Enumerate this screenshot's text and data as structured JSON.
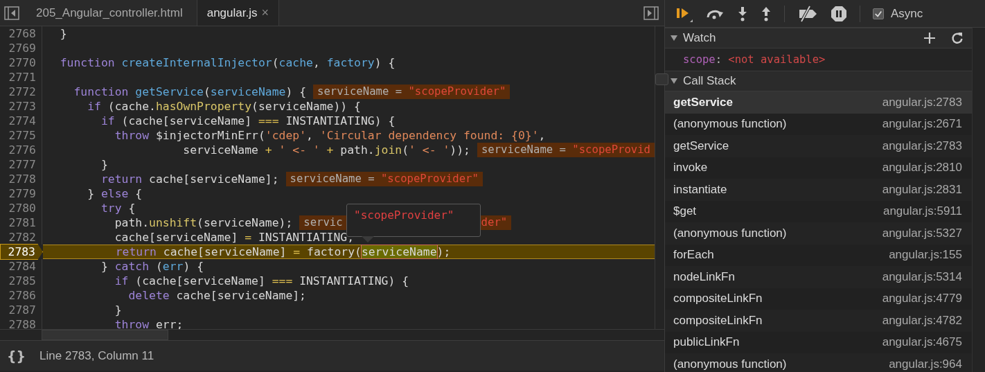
{
  "tabs": [
    {
      "label": "205_Angular_controller.html",
      "selected": false
    },
    {
      "label": "angular.js",
      "selected": true,
      "close_glyph": "×"
    }
  ],
  "editor": {
    "lines": [
      {
        "number": "2768",
        "paused": false,
        "tokens": [
          {
            "kind": "plain",
            "text": "  }"
          }
        ]
      },
      {
        "number": "2769",
        "paused": false
      },
      {
        "number": "2770",
        "paused": false,
        "tokens": [
          {
            "kind": "kw",
            "text": "  function "
          },
          {
            "kind": "fn",
            "text": "createInternalInjector"
          },
          {
            "kind": "plain",
            "text": "("
          },
          {
            "kind": "fn",
            "text": "cache"
          },
          {
            "kind": "plain",
            "text": ", "
          },
          {
            "kind": "fn",
            "text": "factory"
          },
          {
            "kind": "plain",
            "text": ") {"
          }
        ]
      },
      {
        "number": "2771",
        "paused": false
      },
      {
        "number": "2772",
        "paused": false,
        "tokens": [
          {
            "kind": "kw",
            "text": "    function "
          },
          {
            "kind": "fn",
            "text": "getService"
          },
          {
            "kind": "plain",
            "text": "("
          },
          {
            "kind": "fn",
            "text": "serviceName"
          },
          {
            "kind": "plain",
            "text": ") {"
          }
        ],
        "inline_values": [
          {
            "name": "serviceName = ",
            "value": "\"scopeProvider\""
          }
        ]
      },
      {
        "number": "2773",
        "paused": false,
        "tokens": [
          {
            "kind": "kw",
            "text": "      if"
          },
          {
            "kind": "plain",
            "text": " (cache."
          },
          {
            "kind": "method",
            "text": "hasOwnProperty"
          },
          {
            "kind": "plain",
            "text": "(serviceName)) {"
          }
        ]
      },
      {
        "number": "2774",
        "paused": false,
        "tokens": [
          {
            "kind": "kw",
            "text": "        if"
          },
          {
            "kind": "plain",
            "text": " (cache[serviceName] "
          },
          {
            "kind": "op",
            "text": "==="
          },
          {
            "kind": "plain",
            "text": " INSTANTIATING) {"
          }
        ]
      },
      {
        "number": "2775",
        "paused": false,
        "tokens": [
          {
            "kind": "kw",
            "text": "          throw"
          },
          {
            "kind": "plain",
            "text": " $injectorMinErr("
          },
          {
            "kind": "str",
            "text": "'cdep'"
          },
          {
            "kind": "plain",
            "text": ", "
          },
          {
            "kind": "str",
            "text": "'Circular dependency found: {0}'"
          },
          {
            "kind": "plain",
            "text": ","
          }
        ]
      },
      {
        "number": "2776",
        "paused": false,
        "tokens": [
          {
            "kind": "plain",
            "text": "                    serviceName "
          },
          {
            "kind": "op",
            "text": "+"
          },
          {
            "kind": "str",
            "text": " ' <- ' "
          },
          {
            "kind": "op",
            "text": "+"
          },
          {
            "kind": "plain",
            "text": " path."
          },
          {
            "kind": "method",
            "text": "join"
          },
          {
            "kind": "plain",
            "text": "("
          },
          {
            "kind": "str",
            "text": "' <- '"
          },
          {
            "kind": "plain",
            "text": "));"
          }
        ],
        "inline_values": [
          {
            "name": "serviceName = ",
            "value": "\"scopeProvid"
          }
        ]
      },
      {
        "number": "2777",
        "paused": false,
        "tokens": [
          {
            "kind": "plain",
            "text": "        }"
          }
        ]
      },
      {
        "number": "2778",
        "paused": false,
        "tokens": [
          {
            "kind": "kw",
            "text": "        return"
          },
          {
            "kind": "plain",
            "text": " cache[serviceName];"
          }
        ],
        "inline_values": [
          {
            "name": "serviceName = ",
            "value": "\"scopeProvider\""
          }
        ]
      },
      {
        "number": "2779",
        "paused": false,
        "tokens": [
          {
            "kind": "plain",
            "text": "      } "
          },
          {
            "kind": "kw",
            "text": "else"
          },
          {
            "kind": "plain",
            "text": " {"
          }
        ]
      },
      {
        "number": "2780",
        "paused": false,
        "tokens": [
          {
            "kind": "kw",
            "text": "        try"
          },
          {
            "kind": "plain",
            "text": " {"
          }
        ]
      },
      {
        "number": "2781",
        "paused": false,
        "tokens": [
          {
            "kind": "plain",
            "text": "          path."
          },
          {
            "kind": "method",
            "text": "unshift"
          },
          {
            "kind": "plain",
            "text": "(serviceName);"
          }
        ],
        "inline_values": [
          {
            "name": "servic"
          },
          {
            "value": "der\""
          }
        ]
      },
      {
        "number": "2782",
        "paused": false,
        "tokens": [
          {
            "kind": "plain",
            "text": "          cache[serviceName] "
          },
          {
            "kind": "op",
            "text": "="
          },
          {
            "kind": "plain",
            "text": " INSTANTIATING,"
          }
        ]
      },
      {
        "number": "2783",
        "paused": true,
        "tokens": [
          {
            "kind": "kw",
            "text": "          return"
          },
          {
            "kind": "plain",
            "text": " cache[serviceName] "
          },
          {
            "kind": "op",
            "text": "="
          },
          {
            "kind": "plain",
            "text": " factory("
          },
          {
            "kind": "hl",
            "text": "serviceName"
          },
          {
            "kind": "plain",
            "text": ");"
          }
        ]
      },
      {
        "number": "2784",
        "paused": false,
        "tokens": [
          {
            "kind": "plain",
            "text": "        } "
          },
          {
            "kind": "kw",
            "text": "catch"
          },
          {
            "kind": "plain",
            "text": " ("
          },
          {
            "kind": "fn",
            "text": "err"
          },
          {
            "kind": "plain",
            "text": ") {"
          }
        ]
      },
      {
        "number": "2785",
        "paused": false,
        "tokens": [
          {
            "kind": "kw",
            "text": "          if"
          },
          {
            "kind": "plain",
            "text": " (cache[serviceName] "
          },
          {
            "kind": "op",
            "text": "==="
          },
          {
            "kind": "plain",
            "text": " INSTANTIATING) {"
          }
        ]
      },
      {
        "number": "2786",
        "paused": false,
        "tokens": [
          {
            "kind": "kw",
            "text": "            delete"
          },
          {
            "kind": "plain",
            "text": " cache[serviceName];"
          }
        ]
      },
      {
        "number": "2787",
        "paused": false,
        "tokens": [
          {
            "kind": "plain",
            "text": "          }"
          }
        ]
      },
      {
        "number": "2788",
        "paused": false,
        "tokens": [
          {
            "kind": "kw",
            "text": "          throw"
          },
          {
            "kind": "plain",
            "text": " err;"
          }
        ]
      }
    ],
    "tooltip": {
      "text": "\"scopeProvider\""
    }
  },
  "status_bar": {
    "format_glyph": "{}",
    "position": "Line 2783, Column 11"
  },
  "debugger": {
    "async": {
      "label": "Async",
      "checked": true
    },
    "watch": {
      "title": "Watch",
      "expanded": true,
      "items": [
        {
          "name": "scope",
          "separator": ":",
          "value": "<not available>"
        }
      ]
    },
    "call_stack": {
      "title": "Call Stack",
      "expanded": true,
      "frames": [
        {
          "function": "getService",
          "location": "angular.js:2783",
          "selected": true
        },
        {
          "function": "(anonymous function)",
          "location": "angular.js:2671",
          "selected": false
        },
        {
          "function": "getService",
          "location": "angular.js:2783",
          "selected": false
        },
        {
          "function": "invoke",
          "location": "angular.js:2810",
          "selected": false
        },
        {
          "function": "instantiate",
          "location": "angular.js:2831",
          "selected": false
        },
        {
          "function": "$get",
          "location": "angular.js:5911",
          "selected": false
        },
        {
          "function": "(anonymous function)",
          "location": "angular.js:5327",
          "selected": false
        },
        {
          "function": "forEach",
          "location": "angular.js:155",
          "selected": false
        },
        {
          "function": "nodeLinkFn",
          "location": "angular.js:5314",
          "selected": false
        },
        {
          "function": "compositeLinkFn",
          "location": "angular.js:4779",
          "selected": false
        },
        {
          "function": "compositeLinkFn",
          "location": "angular.js:4782",
          "selected": false
        },
        {
          "function": "publicLinkFn",
          "location": "angular.js:4675",
          "selected": false
        },
        {
          "function": "(anonymous function)",
          "location": "angular.js:964",
          "selected": false
        }
      ]
    }
  }
}
